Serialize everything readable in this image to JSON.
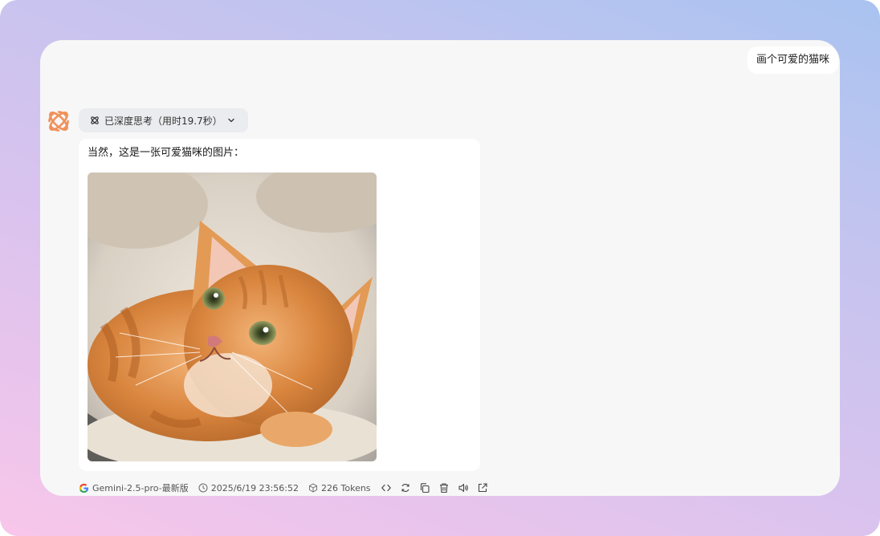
{
  "conversation": {
    "user_message": "画个可爱的猫咪",
    "assistant": {
      "thinking_label": "已深度思考（用时19.7秒）",
      "response_text": "当然，这是一张可爱猫咪的图片：",
      "image_subject": "orange tabby kitten lying in a round cushioned cat bed",
      "meta": {
        "model": "Gemini-2.5-pro-最新版",
        "timestamp": "2025/6/19 23:56:52",
        "tokens": "226 Tokens"
      },
      "actions": [
        "code-icon",
        "regenerate-icon",
        "copy-icon",
        "delete-icon",
        "speaker-icon",
        "share-icon"
      ]
    }
  },
  "colors": {
    "accent": "#f0915a",
    "google_blue": "#4285f4",
    "google_red": "#ea4335",
    "google_yellow": "#fbbc05",
    "google_green": "#34a853"
  }
}
